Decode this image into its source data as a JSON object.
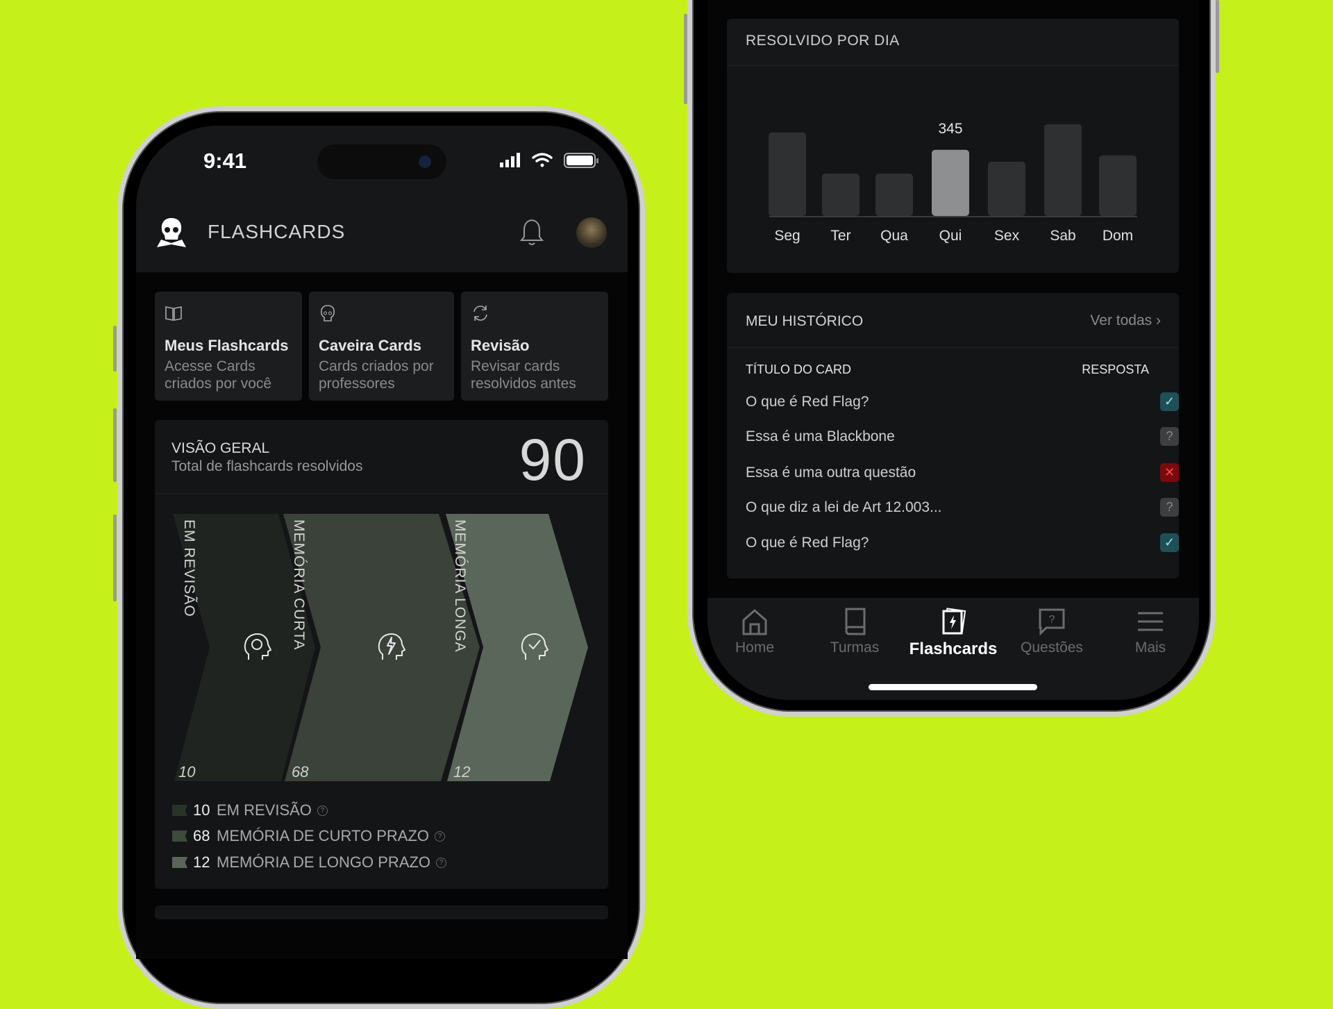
{
  "status_bar": {
    "time": "9:41"
  },
  "header": {
    "title": "FLASHCARDS",
    "logo_icon": "skull-book-icon",
    "bell_icon": "bell-icon",
    "avatar_icon": "user-avatar"
  },
  "quick_cards": [
    {
      "icon": "book-open-icon",
      "title": "Meus Flashcards",
      "line1": "Acesse Cards",
      "line2": "criados por você"
    },
    {
      "icon": "skull-icon",
      "title": "Caveira Cards",
      "line1": "Cards criados por",
      "line2": "professores"
    },
    {
      "icon": "refresh-icon",
      "title": "Revisão",
      "line1": "Revisar cards",
      "line2": "resolvidos antes"
    }
  ],
  "overview": {
    "title": "VISÃO GERAL",
    "subtitle": "Total de flashcards resolvidos",
    "total": "90",
    "stages": [
      {
        "label": "EM REVISÃO",
        "count": "10",
        "icon": "head-cycle-icon",
        "color": "#1f2420"
      },
      {
        "label": "MEMÓRIA CURTA",
        "count": "68",
        "icon": "head-lightning-icon",
        "color": "#3a4239"
      },
      {
        "label": "MEMÓRIA LONGA",
        "count": "12",
        "icon": "head-check-icon",
        "color": "#5a6659"
      }
    ],
    "legend": [
      {
        "count": "10",
        "label": "EM REVISÃO",
        "color": "#2a3328"
      },
      {
        "count": "68",
        "label": "MEMÓRIA DE CURTO PRAZO",
        "color": "#3e4a3c"
      },
      {
        "count": "12",
        "label": "MEMÓRIA DE LONGO PRAZO",
        "color": "#5a6659"
      }
    ]
  },
  "chart_data": {
    "type": "bar",
    "title": "RESOLVIDO POR DIA",
    "categories": [
      "Seg",
      "Ter",
      "Qua",
      "Qui",
      "Sex",
      "Sab",
      "Dom"
    ],
    "values": [
      436,
      221,
      221,
      345,
      283,
      479,
      316
    ],
    "highlight": "Qui",
    "highlight_label": "345",
    "ylim": [
      0,
      500
    ],
    "grid": false,
    "colors": {
      "bar": "#2f3032",
      "highlight": "#8e8f90"
    }
  },
  "history": {
    "title": "MEU HISTÓRICO",
    "see_all": "Ver todas",
    "col_title": "TÍTULO DO CARD",
    "col_answer": "RESPOSTA",
    "rows": [
      {
        "title": "O que é Red Flag?",
        "answer": "correct"
      },
      {
        "title": "Essa é uma Blackbone",
        "answer": "unknown"
      },
      {
        "title": "Essa é uma outra questão",
        "answer": "wrong"
      },
      {
        "title": "O que diz a lei de Art 12.003...",
        "answer": "unknown"
      },
      {
        "title": "O que é Red Flag?",
        "answer": "correct"
      }
    ],
    "badge_glyphs": {
      "correct": "✓",
      "unknown": "?",
      "wrong": "✕"
    }
  },
  "bottom_nav": [
    {
      "label": "Home",
      "icon": "home-icon",
      "active": false
    },
    {
      "label": "Turmas",
      "icon": "book-icon",
      "active": false
    },
    {
      "label": "Flashcards",
      "icon": "flashcards-icon",
      "active": true
    },
    {
      "label": "Questões",
      "icon": "question-chat-icon",
      "active": false
    },
    {
      "label": "Mais",
      "icon": "menu-icon",
      "active": false
    }
  ],
  "colors": {
    "background": "#c6f01a",
    "correct": "#1f4f57",
    "wrong": "#7a0a0e",
    "unknown": "#3d3e40"
  }
}
